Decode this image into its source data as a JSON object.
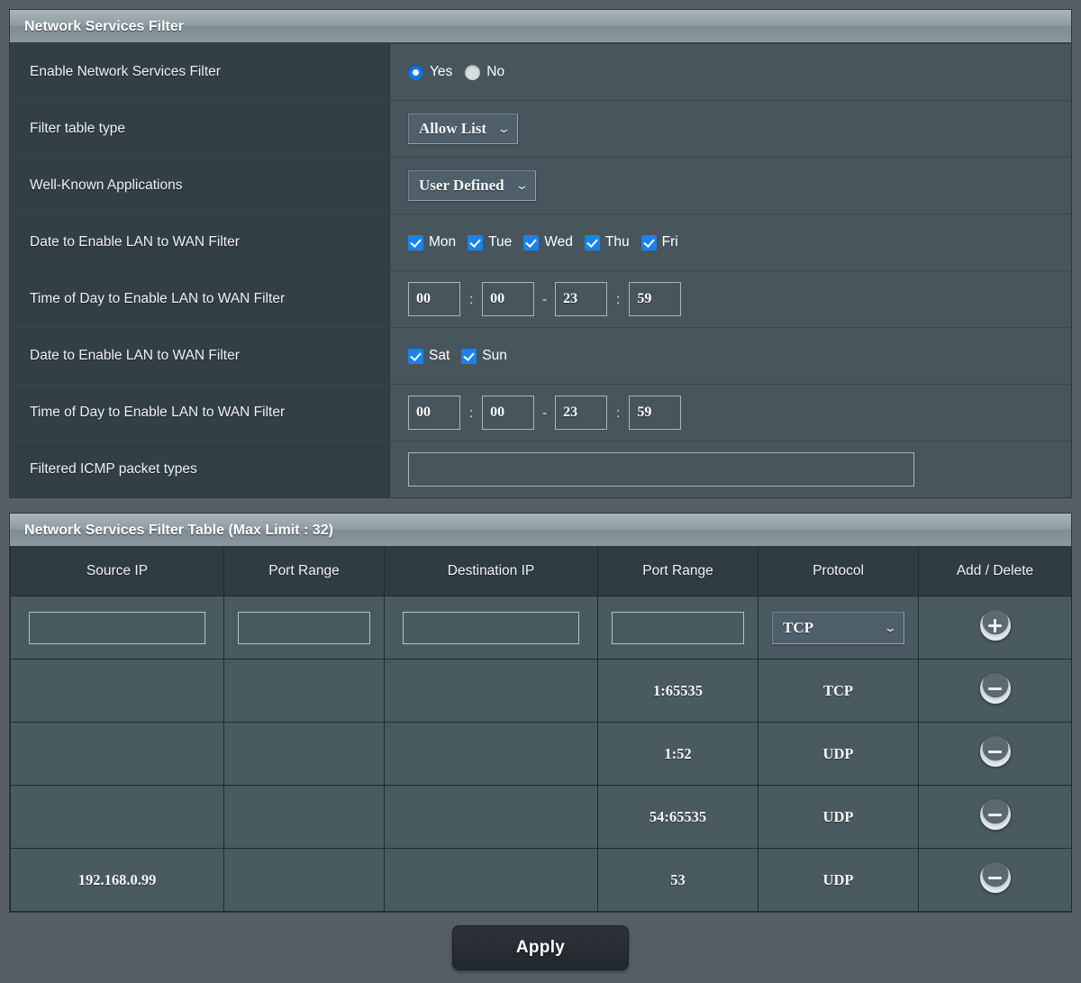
{
  "settings_panel": {
    "title": "Network Services Filter",
    "rows": {
      "enable": {
        "label": "Enable Network Services Filter",
        "yes_label": "Yes",
        "no_label": "No",
        "selected": "Yes"
      },
      "filter_table_type": {
        "label": "Filter table type",
        "value": "Allow List"
      },
      "well_known_applications": {
        "label": "Well-Known Applications",
        "value": "User Defined"
      },
      "date_weekday": {
        "label": "Date to Enable LAN to WAN Filter",
        "days": [
          {
            "name": "Mon",
            "checked": true
          },
          {
            "name": "Tue",
            "checked": true
          },
          {
            "name": "Wed",
            "checked": true
          },
          {
            "name": "Thu",
            "checked": true
          },
          {
            "name": "Fri",
            "checked": true
          }
        ]
      },
      "time_weekday": {
        "label": "Time of Day to Enable LAN to WAN Filter",
        "start_hour": "00",
        "start_min": "00",
        "end_hour": "23",
        "end_min": "59",
        "colon": ":",
        "dash": "-"
      },
      "date_weekend": {
        "label": "Date to Enable LAN to WAN Filter",
        "days": [
          {
            "name": "Sat",
            "checked": true
          },
          {
            "name": "Sun",
            "checked": true
          }
        ]
      },
      "time_weekend": {
        "label": "Time of Day to Enable LAN to WAN Filter",
        "start_hour": "00",
        "start_min": "00",
        "end_hour": "23",
        "end_min": "59",
        "colon": ":",
        "dash": "-"
      },
      "icmp": {
        "label": "Filtered ICMP packet types",
        "value": "",
        "placeholder": ""
      }
    }
  },
  "filter_table_panel": {
    "title": "Network Services Filter Table (Max Limit : 32)",
    "columns": [
      "Source IP",
      "Port Range",
      "Destination IP",
      "Port Range",
      "Protocol",
      "Add / Delete"
    ],
    "new_row": {
      "source_ip": "",
      "source_port": "",
      "dest_ip": "",
      "dest_port": "",
      "protocol": "TCP",
      "action_icon": "plus-circle-icon"
    },
    "rows": [
      {
        "source_ip": "",
        "source_port": "",
        "dest_ip": "",
        "dest_port": "1:65535",
        "protocol": "TCP",
        "action_icon": "minus-circle-icon"
      },
      {
        "source_ip": "",
        "source_port": "",
        "dest_ip": "",
        "dest_port": "1:52",
        "protocol": "UDP",
        "action_icon": "minus-circle-icon"
      },
      {
        "source_ip": "",
        "source_port": "",
        "dest_ip": "",
        "dest_port": "54:65535",
        "protocol": "UDP",
        "action_icon": "minus-circle-icon"
      },
      {
        "source_ip": "192.168.0.99",
        "source_port": "",
        "dest_ip": "",
        "dest_port": "53",
        "protocol": "UDP",
        "action_icon": "minus-circle-icon"
      }
    ]
  },
  "footer": {
    "apply_label": "Apply"
  },
  "icons": {
    "chevron_down": "⌄"
  },
  "colors": {
    "page_background": "#555f65",
    "label_cell": "#333f47",
    "value_cell": "#47565d",
    "panel_header_light": "#aab6bb",
    "table_header": "#303c44",
    "table_cell": "#4a5a61",
    "accent_blue": "#1a82ec",
    "apply_button": "#262c32"
  }
}
